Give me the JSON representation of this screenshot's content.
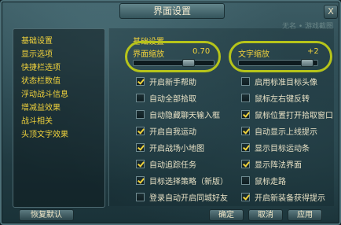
{
  "window": {
    "title": "界面设置",
    "close_label": "X",
    "watermark": "无名 • 游戏截图"
  },
  "sidebar": {
    "items": [
      {
        "label": "基础设置"
      },
      {
        "label": "显示选项"
      },
      {
        "label": "快捷栏选项"
      },
      {
        "label": "状态栏数值"
      },
      {
        "label": "浮动战斗信息"
      },
      {
        "label": "增减益效果"
      },
      {
        "label": "战斗相关"
      },
      {
        "label": "头顶文字效果"
      }
    ]
  },
  "main": {
    "section_title": "基础设置",
    "sliders": [
      {
        "label": "界面缩放",
        "value_text": "0.70",
        "value": 0.7
      },
      {
        "label": "文字缩放",
        "value_text": "+2",
        "value": 0.92
      }
    ],
    "options_left": [
      {
        "label": "开启新手帮助",
        "checked": true
      },
      {
        "label": "自动全部拾取",
        "checked": false
      },
      {
        "label": "自动隐藏聊天输入框",
        "checked": false
      },
      {
        "label": "开启自我运动",
        "checked": true
      },
      {
        "label": "开启战场小地图",
        "checked": true
      },
      {
        "label": "自动追踪任务",
        "checked": true
      },
      {
        "label": "目标选择策略（新版）",
        "checked": true
      },
      {
        "label": "登录自动开启同城好友",
        "checked": false
      }
    ],
    "options_right": [
      {
        "label": "启用标准目标头像",
        "checked": false
      },
      {
        "label": "鼠标左右键反转",
        "checked": false
      },
      {
        "label": "鼠标位置打开拾取窗口",
        "checked": true
      },
      {
        "label": "自动显示上线提示",
        "checked": true
      },
      {
        "label": "显示目标运动条",
        "checked": true
      },
      {
        "label": "显示阵法界面",
        "checked": true
      },
      {
        "label": "鼠标走路",
        "checked": false
      },
      {
        "label": "开启新装备获得提示",
        "checked": true
      }
    ]
  },
  "footer": {
    "reset_label": "恢复默认",
    "ok_label": "确定",
    "cancel_label": "取消",
    "apply_label": "应用"
  }
}
